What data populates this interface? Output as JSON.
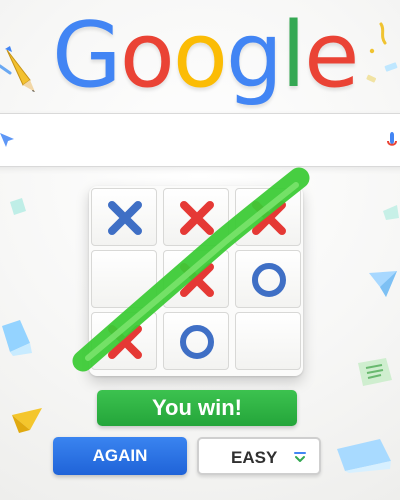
{
  "logo": {
    "letters": [
      {
        "char": "G",
        "color": "#4285F4"
      },
      {
        "char": "o",
        "color": "#EA4335"
      },
      {
        "char": "o",
        "color": "#FBBC05"
      },
      {
        "char": "g",
        "color": "#4285F4"
      },
      {
        "char": "l",
        "color": "#34A853"
      },
      {
        "char": "e",
        "color": "#EA4335"
      }
    ]
  },
  "search": {
    "left_icon": "search-icon",
    "right_icon": "mic-icon"
  },
  "game": {
    "board": [
      [
        "X",
        "X",
        "X"
      ],
      [
        "",
        "X",
        "O"
      ],
      [
        "X",
        "O",
        ""
      ]
    ],
    "winning_line": "diagonal bottom-left to top-right",
    "result_text": "You win!",
    "again_label": "AGAIN",
    "difficulty_label": "EASY",
    "x_color": "#E53935",
    "x_color_top_left": "#3F6FC5",
    "o_color": "#3F6FC5",
    "win_color": "#3CCB35"
  },
  "decorations": [
    "pencil-icon",
    "ticket-icon",
    "paper-plane-icon",
    "paper-scrap-icon",
    "confetti-icon"
  ]
}
